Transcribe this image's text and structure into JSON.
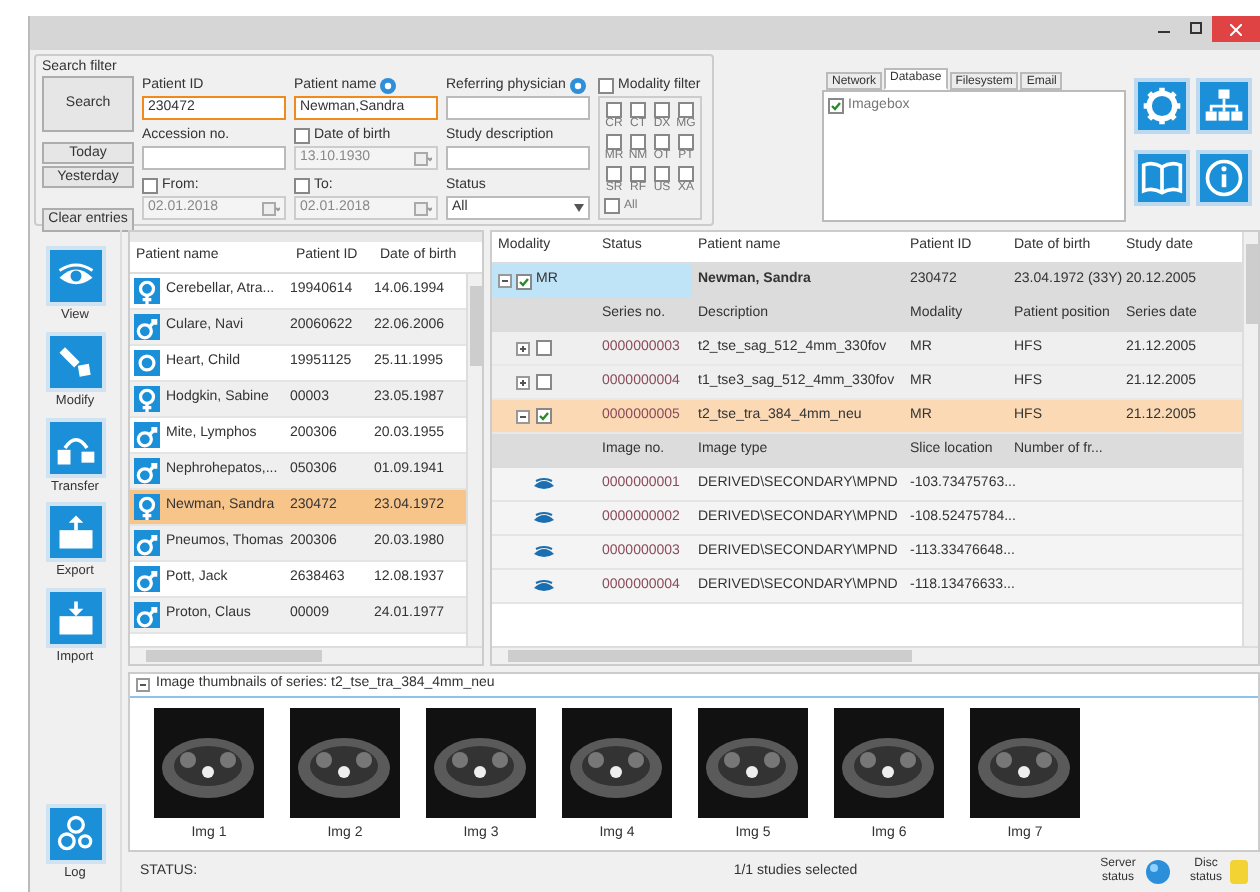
{
  "filter": {
    "title": "Search filter",
    "buttons": [
      {
        "label": "Search"
      },
      {
        "label": "Today"
      },
      {
        "label": "Yesterday"
      },
      {
        "label": "Clear entries"
      }
    ],
    "patient_id": {
      "label": "Patient ID",
      "value": "230472",
      "highlighted": true
    },
    "patient_name": {
      "label": "Patient name",
      "value": "Newman,Sandra",
      "highlighted": true
    },
    "referring_physician": {
      "label": "Referring physician",
      "highlighted": false
    },
    "accession_no": {
      "label": "Accession no.",
      "highlighted": false
    },
    "date_of_birth": {
      "label": "Date of birth",
      "checked": false,
      "value": "13.10.1930"
    },
    "study_description": {
      "label": "Study description",
      "highlighted": false
    },
    "from": {
      "label": "From:",
      "checked": false,
      "value": "02.01.2018"
    },
    "to": {
      "label": "To:",
      "checked": false,
      "value": "02.01.2018"
    },
    "status": {
      "label": "Status",
      "value": "All"
    },
    "modality_filter": {
      "label": "Modality filter",
      "checked": false,
      "modalities": [
        {
          "label": "CR",
          "checked": false
        },
        {
          "label": "CT",
          "checked": false
        },
        {
          "label": "DX",
          "checked": false
        },
        {
          "label": "MG",
          "checked": false
        },
        {
          "label": "MR",
          "checked": false
        },
        {
          "label": "NM",
          "checked": false
        },
        {
          "label": "OT",
          "checked": false
        },
        {
          "label": "PT",
          "checked": false
        },
        {
          "label": "SR",
          "checked": false
        },
        {
          "label": "RF",
          "checked": false
        },
        {
          "label": "US",
          "checked": false
        },
        {
          "label": "XA",
          "checked": false
        }
      ],
      "all": {
        "label": "All",
        "checked": false
      }
    }
  },
  "source_tabs": [
    {
      "label": "Network",
      "selected": false
    },
    {
      "label": "Database",
      "selected": true
    },
    {
      "label": "Filesystem",
      "selected": false
    },
    {
      "label": "Email",
      "selected": false
    }
  ],
  "source_items": [
    {
      "label": "Imagebox",
      "checked": true
    }
  ],
  "actions": [
    {
      "label": "View"
    },
    {
      "label": "Modify"
    },
    {
      "label": "Transfer"
    },
    {
      "label": "Export"
    },
    {
      "label": "Import"
    }
  ],
  "log": {
    "label": "Log"
  },
  "patients": {
    "columns": [
      "Patient name",
      "Patient ID",
      "Date of birth"
    ],
    "rows": [
      {
        "kind": "female",
        "name": "Cerebellar, Atra...",
        "id": "19940614",
        "dob": "14.06.1994",
        "selected": false
      },
      {
        "kind": "male",
        "name": "Culare, Navi",
        "id": "20060622",
        "dob": "22.06.2006",
        "selected": false
      },
      {
        "kind": "unknown",
        "name": "Heart, Child",
        "id": "19951125",
        "dob": "25.11.1995",
        "selected": false
      },
      {
        "kind": "female",
        "name": "Hodgkin, Sabine",
        "id": "00003",
        "dob": "23.05.1987",
        "selected": false
      },
      {
        "kind": "male",
        "name": "Mite, Lymphos",
        "id": "200306",
        "dob": "20.03.1955",
        "selected": false
      },
      {
        "kind": "male",
        "name": "Nephrohepatos,...",
        "id": "050306",
        "dob": "01.09.1941",
        "selected": false
      },
      {
        "kind": "female",
        "name": "Newman, Sandra",
        "id": "230472",
        "dob": "23.04.1972",
        "selected": true
      },
      {
        "kind": "male",
        "name": "Pneumos, Thomas",
        "id": "200306",
        "dob": "20.03.1980",
        "selected": false
      },
      {
        "kind": "male",
        "name": "Pott, Jack",
        "id": "2638463",
        "dob": "12.08.1937",
        "selected": false
      },
      {
        "kind": "male",
        "name": "Proton, Claus",
        "id": "00009",
        "dob": "24.01.1977",
        "selected": false
      }
    ]
  },
  "studies": {
    "columns": [
      "Modality",
      "Status",
      "Patient name",
      "Patient ID",
      "Date of birth",
      "Study date"
    ],
    "study": {
      "expanded": true,
      "checked": true,
      "selected": true,
      "modality": "MR",
      "patient_name": "Newman, Sandra",
      "patient_id": "230472",
      "dob": "23.04.1972 (33Y)",
      "study_date": "20.12.2005"
    },
    "series_columns": [
      "Series no.",
      "Description",
      "Modality",
      "Patient position",
      "Series date"
    ],
    "series": [
      {
        "expanded": false,
        "checked": false,
        "selected": false,
        "no": "0000000003",
        "description": "t2_tse_sag_512_4mm_330fov",
        "modality": "MR",
        "position": "HFS",
        "date": "21.12.2005"
      },
      {
        "expanded": false,
        "checked": false,
        "selected": false,
        "no": "0000000004",
        "description": "t1_tse3_sag_512_4mm_330fov",
        "modality": "MR",
        "position": "HFS",
        "date": "21.12.2005"
      },
      {
        "expanded": true,
        "checked": true,
        "selected": true,
        "no": "0000000005",
        "description": "t2_tse_tra_384_4mm_neu",
        "modality": "MR",
        "position": "HFS",
        "date": "21.12.2005"
      }
    ],
    "image_columns": [
      "Image no.",
      "Image type",
      "Slice location",
      "Number of fr..."
    ],
    "images": [
      {
        "no": "0000000001",
        "type": "DERIVED\\SECONDARY\\MPND",
        "slice": "-103.73475763..."
      },
      {
        "no": "0000000002",
        "type": "DERIVED\\SECONDARY\\MPND",
        "slice": "-108.52475784..."
      },
      {
        "no": "0000000003",
        "type": "DERIVED\\SECONDARY\\MPND",
        "slice": "-113.33476648..."
      },
      {
        "no": "0000000004",
        "type": "DERIVED\\SECONDARY\\MPND",
        "slice": "-118.13476633..."
      }
    ]
  },
  "thumbnails": {
    "expanded": true,
    "title": "Image thumbnails of series: t2_tse_tra_384_4mm_neu",
    "images": [
      "Img 1",
      "Img 2",
      "Img 3",
      "Img 4",
      "Img 5",
      "Img 6",
      "Img 7"
    ]
  },
  "status_bar": {
    "label": "STATUS:",
    "message": "1/1 studies selected",
    "server_status": "Server status",
    "disc_status": "Disc status"
  }
}
